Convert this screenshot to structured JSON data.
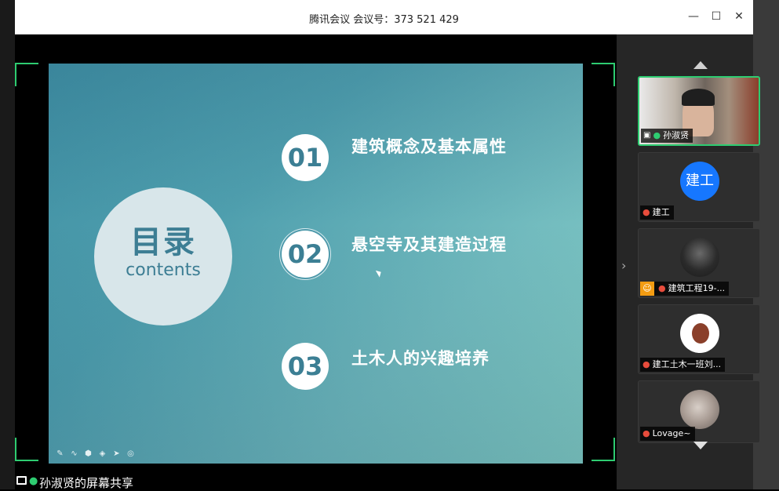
{
  "window": {
    "title": "腾讯会议 会议号：373 521 429"
  },
  "controls": {
    "minimize": "—",
    "maximize": "☐",
    "close": "✕"
  },
  "slide": {
    "heading_cn": "目录",
    "heading_en": "contents",
    "items": [
      {
        "number": "01",
        "label": "建筑概念及基本属性"
      },
      {
        "number": "02",
        "label": "悬空寺及其建造过程"
      },
      {
        "number": "03",
        "label": "土木人的兴趣培养"
      }
    ],
    "tools": [
      "✎",
      "∿",
      "⬢",
      "◈",
      "➤",
      "◎"
    ]
  },
  "share": {
    "label": "孙淑贤的屏幕共享"
  },
  "participants": [
    {
      "name": "孙淑贤",
      "type": "video",
      "mic": "on"
    },
    {
      "name": "建工",
      "type": "text-avatar",
      "avatar_text": "建工",
      "mic": "muted"
    },
    {
      "name": "建筑工程19-...",
      "type": "image-avatar",
      "mic": "muted",
      "host": true
    },
    {
      "name": "建工土木一班刘...",
      "type": "image-avatar",
      "mic": "muted"
    },
    {
      "name": "Lovage~",
      "type": "image-avatar",
      "mic": "muted"
    }
  ],
  "colors": {
    "active_border": "#2ecc71",
    "muted": "#e74c3c",
    "avatar_blue": "#1677ff"
  }
}
